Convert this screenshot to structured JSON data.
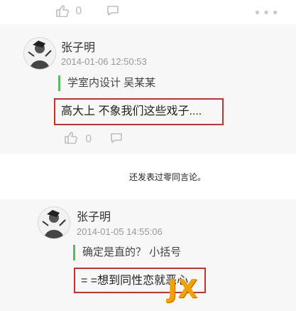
{
  "top_actions": {
    "like_count": "0",
    "more_label": "•••"
  },
  "comment1": {
    "username": "张子明",
    "timestamp": "2014-01-06 12:50:53",
    "quote": "学室内设计 吴某某",
    "reply": "高大上 不象我们这些戏子....",
    "like_count": "0"
  },
  "caption": "还发表过零同言论。",
  "comment2": {
    "username": "张子明",
    "timestamp": "2014-01-05 14:55:06",
    "quote": "确定是直的？ 小括号",
    "reply": "= =想到同性恋就恶心"
  },
  "watermark": {
    "text": "JX"
  },
  "colors": {
    "quote_bar": "#59b86a",
    "highlight_border": "#c9322b",
    "watermark": "#f2a100"
  }
}
